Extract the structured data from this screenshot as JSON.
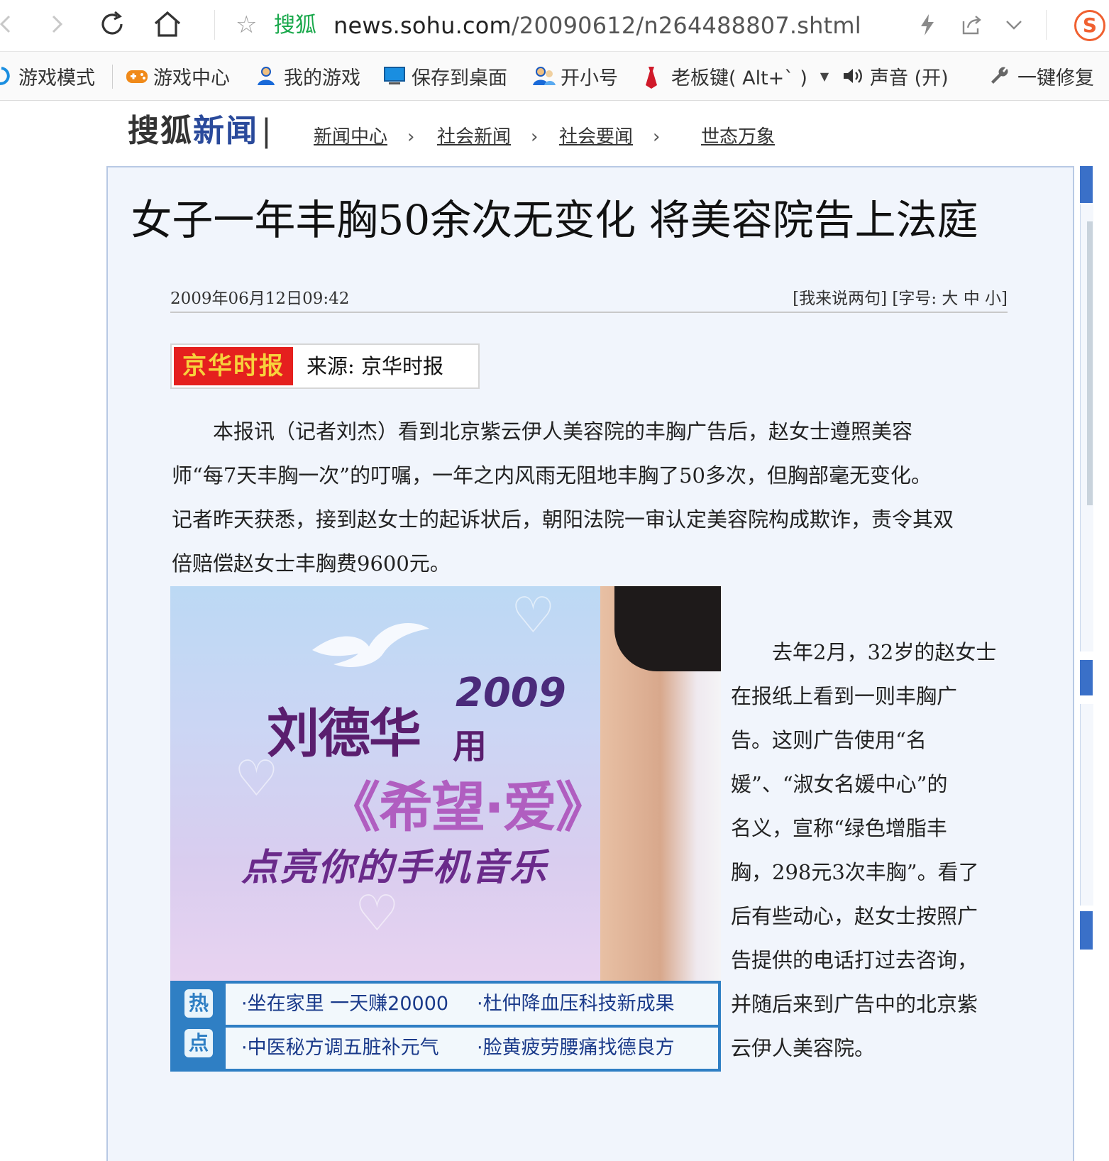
{
  "browser": {
    "brand": "搜狐",
    "url_domain": "news.sohu.com",
    "url_path": "/20090612/n264488807.shtml",
    "sogou_badge": "S"
  },
  "bookmarks": [
    {
      "label": "游戏模式",
      "icon": "game-mode-icon"
    },
    {
      "label": "游戏中心",
      "icon": "gamepad-icon"
    },
    {
      "label": "我的游戏",
      "icon": "user-icon"
    },
    {
      "label": "保存到桌面",
      "icon": "monitor-icon"
    },
    {
      "label": "开小号",
      "icon": "users-icon"
    },
    {
      "label": "老板键( Alt+` )",
      "icon": "tie-icon"
    },
    {
      "label": "声音 (开)",
      "icon": "speaker-icon"
    },
    {
      "label": "一键修复",
      "icon": "wrench-icon"
    }
  ],
  "site": {
    "logo_a": "搜狐",
    "logo_b": "新闻",
    "logo_bar": "|",
    "breadcrumb": [
      "新闻中心",
      "社会新闻",
      "社会要闻",
      "世态万象"
    ],
    "separator": "›"
  },
  "article": {
    "title": "女子一年丰胸50余次无变化  将美容院告上法庭",
    "date": "2009年06月12日09:42",
    "tools": "[我来说两句] [字号: 大 中 小]",
    "source_logo": "京华时报",
    "source_text": "来源: 京华时报",
    "para1": [
      "　　本报讯（记者刘杰）看到北京紫云伊人美容院的丰胸广告后，赵女士遵照美容",
      "师“每7天丰胸一次”的叮嘱，一年之内风雨无阻地丰胸了50多次，但胸部毫无变化。",
      "记者昨天获悉，接到赵女士的起诉状后，朝阳法院一审认定美容院构成欺诈，责令其双",
      "倍赔偿赵女士丰胸费9600元。"
    ],
    "para2": [
      "　　去年2月，32岁的赵女士",
      "在报纸上看到一则丰胸广",
      "告。这则广告使用“名",
      "媛”、“淑女名媛中心”的",
      "名义，宣称“绿色增脂丰",
      "胸，298元3次丰胸”。看了",
      "后有些动心，赵女士按照广",
      "告提供的电话打过去咨询，",
      "并随后来到广告中的北京紫",
      "云伊人美容院。"
    ]
  },
  "ad": {
    "year": "2009",
    "name": "刘德华",
    "use": "用",
    "song": "《希望·爱》",
    "sub": "点亮你的手机音乐",
    "hot_1": "热",
    "hot_2": "点",
    "links": [
      "·坐在家里 一天赚20000",
      "·杜仲降血压科技新成果",
      "·中医秘方调五脏补元气",
      "·脸黄疲劳腰痛找德良方"
    ]
  },
  "colors": {
    "brand_green": "#19a84b",
    "logo_blue": "#2a4a9b",
    "box_bg": "#f1f5fc",
    "link_blue": "#1a3a8a"
  }
}
